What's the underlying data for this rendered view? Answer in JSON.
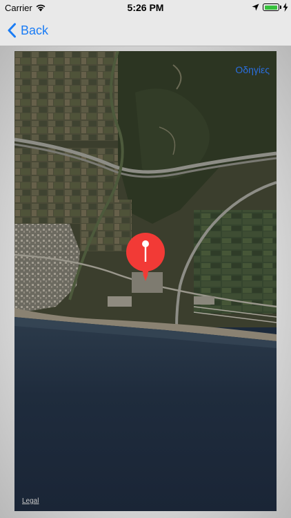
{
  "status_bar": {
    "carrier": "Carrier",
    "time": "5:26 PM",
    "battery_percent": 100
  },
  "nav": {
    "back_label": "Back"
  },
  "map": {
    "directions_label": "Οδηγίες",
    "legal_label": "Legal",
    "map_type": "satellite"
  },
  "colors": {
    "accent": "#1a7cf5",
    "pin": "#f23a36",
    "battery": "#36c13c"
  }
}
